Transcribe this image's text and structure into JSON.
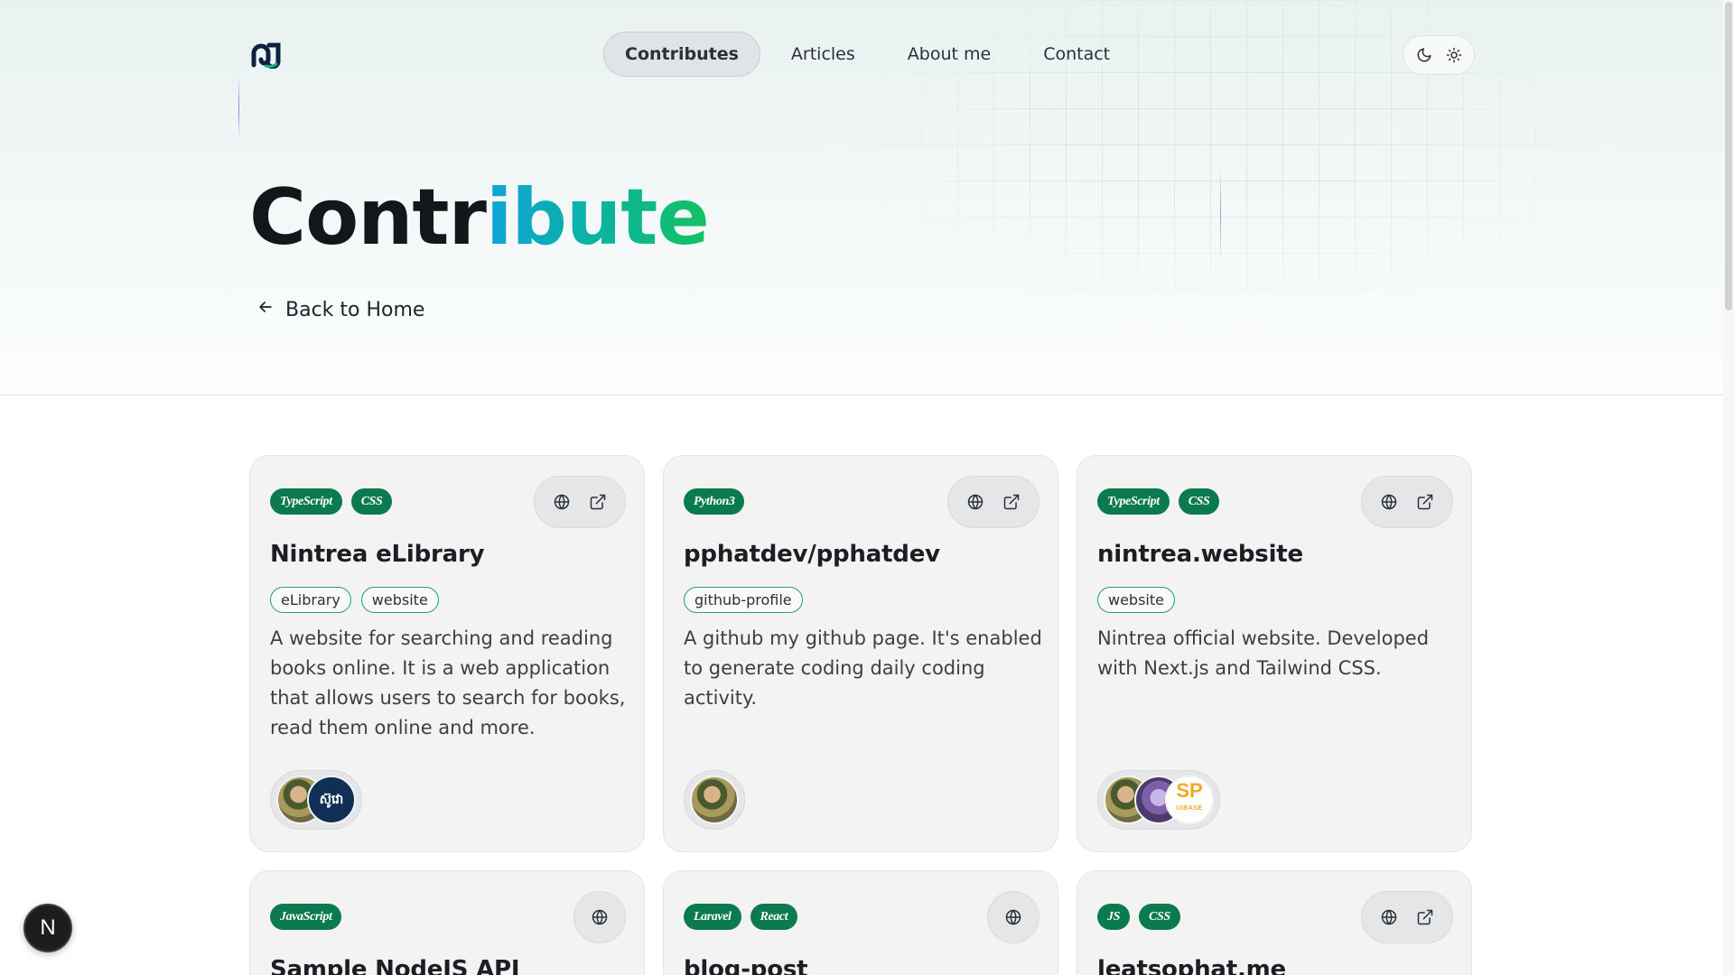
{
  "nav": {
    "items": [
      "Contributes",
      "Articles",
      "About me",
      "Contact"
    ],
    "active_index": 0
  },
  "hero": {
    "title_part1": "Contr",
    "title_part2": "ibute",
    "back_label": "Back to Home"
  },
  "icons": {
    "logo": "logo-icon",
    "moon": "moon-icon",
    "sun": "sun-icon",
    "globe": "globe-icon",
    "external": "external-link-icon",
    "arrow_left": "arrow-left-icon",
    "next": "nextjs-icon"
  },
  "colors": {
    "tech_badge": "#0b7a4f",
    "tag_border": "#25a36b",
    "gradient_start": "#0ea5d6",
    "gradient_end": "#13c25f"
  },
  "cards": [
    {
      "tech": [
        "TypeScript",
        "CSS"
      ],
      "title": "Nintrea eLibrary",
      "tags": [
        "eLibrary",
        "website"
      ],
      "description": "A website for searching and reading books online. It is a web application that allows users to search for books, read them online and more.",
      "actions": [
        "website",
        "source"
      ],
      "avatars": [
        "person",
        "ស៊ូវោ"
      ]
    },
    {
      "tech": [
        "Python3"
      ],
      "title": "pphatdev/pphatdev",
      "tags": [
        "github-profile"
      ],
      "description": "A github my github page. It's enabled to generate coding daily coding activity.",
      "actions": [
        "website",
        "source"
      ],
      "avatars": [
        "person"
      ]
    },
    {
      "tech": [
        "TypeScript",
        "CSS"
      ],
      "title": "nintrea.website",
      "tags": [
        "website"
      ],
      "description": "Nintrea official website. Developed with Next.js and Tailwind CSS.",
      "actions": [
        "website",
        "source"
      ],
      "avatars": [
        "person",
        "purple",
        "SP"
      ],
      "avatar_sp_sub": "UIBASE"
    },
    {
      "tech": [
        "JavaScript"
      ],
      "title": "Sample NodeJS API",
      "actions": [
        "website"
      ]
    },
    {
      "tech": [
        "Laravel",
        "React"
      ],
      "title": "blog-post",
      "actions": [
        "website"
      ]
    },
    {
      "tech": [
        "JS",
        "CSS"
      ],
      "title": "leatsophat.me",
      "actions": [
        "website",
        "source"
      ]
    }
  ],
  "next_badge": "N"
}
